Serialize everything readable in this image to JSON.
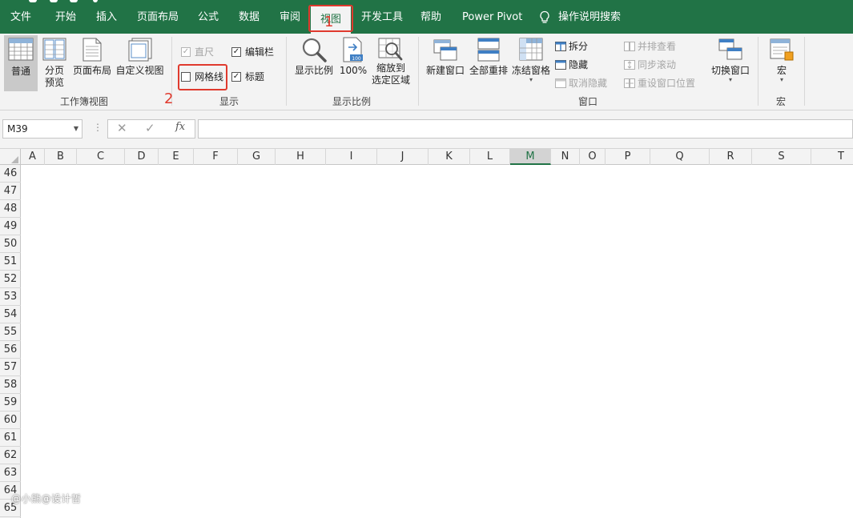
{
  "tabs": [
    "文件",
    "开始",
    "插入",
    "页面布局",
    "公式",
    "数据",
    "审阅",
    "视图",
    "开发工具",
    "帮助",
    "Power Pivot"
  ],
  "active_tab": "视图",
  "tell_me": "操作说明搜索",
  "callouts": [
    "1",
    "2"
  ],
  "ribbon": {
    "workbook_views": {
      "label": "工作簿视图",
      "normal": "普通",
      "page_break_1": "分页",
      "page_break_2": "预览",
      "page_layout": "页面布局",
      "custom_views": "自定义视图"
    },
    "show": {
      "label": "显示",
      "ruler": "直尺",
      "formula_bar": "编辑栏",
      "gridlines": "网格线",
      "headings": "标题",
      "ruler_checked": true,
      "formula_bar_checked": true,
      "gridlines_checked": false,
      "headings_checked": true
    },
    "zoom": {
      "label": "显示比例",
      "zoom": "显示比例",
      "hundred": "100%",
      "zoom_sel_1": "缩放到",
      "zoom_sel_2": "选定区域"
    },
    "window": {
      "label": "窗口",
      "new_window": "新建窗口",
      "arrange_all": "全部重排",
      "freeze_panes": "冻结窗格",
      "split": "拆分",
      "hide": "隐藏",
      "unhide": "取消隐藏",
      "side_by_side": "并排查看",
      "sync_scroll": "同步滚动",
      "reset_position": "重设窗口位置",
      "switch_windows": "切换窗口"
    },
    "macros": {
      "label": "宏",
      "macros": "宏"
    }
  },
  "formula_bar": {
    "name_box": "M39",
    "fx": "fx",
    "content": ""
  },
  "grid": {
    "columns": [
      "A",
      "B",
      "C",
      "D",
      "E",
      "F",
      "G",
      "H",
      "I",
      "J",
      "K",
      "L",
      "M",
      "N",
      "O",
      "P",
      "Q",
      "R",
      "S",
      "T"
    ],
    "active_column": "M",
    "rows": [
      "46",
      "47",
      "48",
      "49",
      "50",
      "51",
      "52",
      "53",
      "54",
      "55",
      "56",
      "57",
      "58",
      "59",
      "60",
      "61",
      "62",
      "63",
      "64",
      "65"
    ]
  },
  "watermark": "@小熊@设计哲",
  "colors": {
    "excel_green": "#217346",
    "callout_red": "#e03a2e",
    "ribbon_bg": "#f3f3f3"
  }
}
